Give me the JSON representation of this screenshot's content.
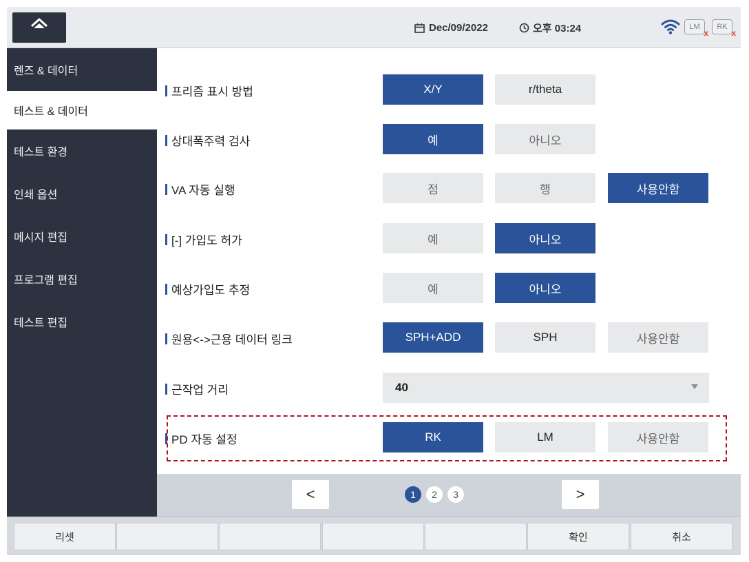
{
  "header": {
    "date": "Dec/09/2022",
    "time": "오후 03:24",
    "lm_badge": "LM",
    "rk_badge": "RK",
    "badge_status": "x"
  },
  "sidebar": {
    "items": [
      {
        "label": "렌즈 & 데이터"
      },
      {
        "label": "테스트 & 데이터"
      },
      {
        "label": "테스트 환경"
      },
      {
        "label": "인쇄 옵션"
      },
      {
        "label": "메시지 편집"
      },
      {
        "label": "프로그램 편집"
      },
      {
        "label": "테스트 편집"
      }
    ],
    "active_index": 1
  },
  "settings": {
    "rows": [
      {
        "label": "프리즘 표시 방법",
        "options": [
          "X/Y",
          "r/theta"
        ],
        "selected": 0
      },
      {
        "label": "상대폭주력 검사",
        "options": [
          "예",
          "아니오"
        ],
        "selected": 0
      },
      {
        "label": "VA 자동 실행",
        "options": [
          "점",
          "행",
          "사용안함"
        ],
        "selected": 2
      },
      {
        "label": "[-] 가입도 허가",
        "options": [
          "예",
          "아니오"
        ],
        "selected": 1
      },
      {
        "label": "예상가입도 추정",
        "options": [
          "예",
          "아니오"
        ],
        "selected": 1
      },
      {
        "label": "원용<->근용 데이터 링크",
        "options": [
          "SPH+ADD",
          "SPH",
          "사용안함"
        ],
        "selected": 0
      },
      {
        "label": "근작업 거리",
        "dropdown_value": "40"
      },
      {
        "label": "PD 자동 설정",
        "options": [
          "RK",
          "LM",
          "사용안함"
        ],
        "selected": 0
      }
    ]
  },
  "pager": {
    "prev": "<",
    "next": ">",
    "pages": [
      "1",
      "2",
      "3"
    ],
    "current": 1
  },
  "bottom": {
    "reset": "리셋",
    "confirm": "확인",
    "cancel": "취소"
  },
  "colors": {
    "accent": "#2b5399",
    "sidebar_bg": "#2c323f",
    "highlight": "#b0121f"
  }
}
